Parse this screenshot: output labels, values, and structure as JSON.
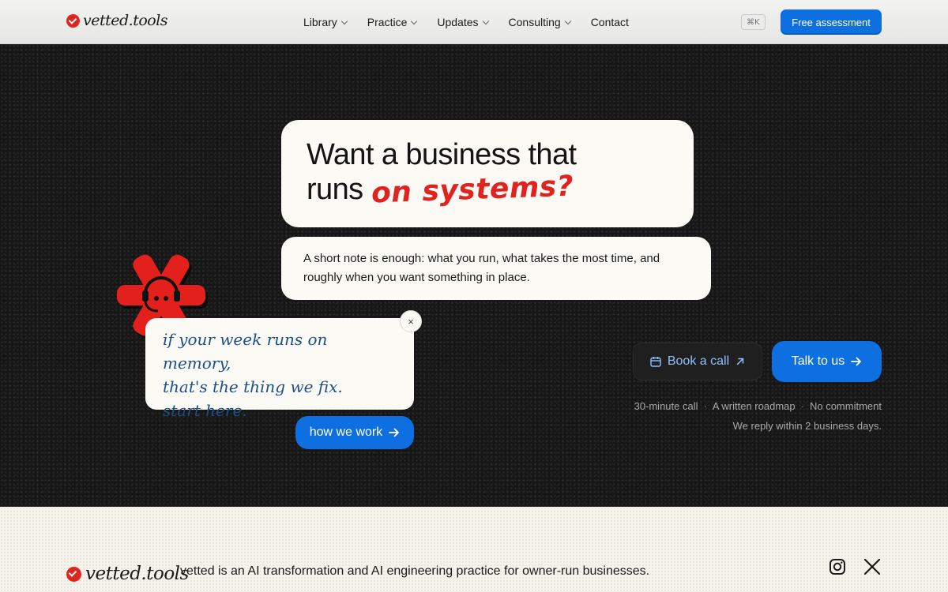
{
  "nav": {
    "brand": "vetted.tools",
    "links": [
      {
        "label": "Library",
        "dropdown": true
      },
      {
        "label": "Practice",
        "dropdown": true
      },
      {
        "label": "Updates",
        "dropdown": true
      },
      {
        "label": "Consulting",
        "dropdown": true
      },
      {
        "label": "Contact",
        "dropdown": false
      }
    ],
    "shortcut": "⌘K",
    "cta": "Free assessment"
  },
  "hero": {
    "title_line1": "Want a business that",
    "title_line2_prefix": "runs",
    "title_accent": "on systems?",
    "note": "A short note is enough: what you run, what takes the most time, and roughly when you want something in place.",
    "sticky_lines": [
      "if your week runs on memory,",
      "that's the thing we fix.",
      "start here."
    ],
    "close_symbol": "×",
    "how_button": "how we work",
    "book_button": "Book a call",
    "talk_button": "Talk to us",
    "meta_items": [
      "30-minute call",
      "A written roadmap",
      "No commitment"
    ],
    "meta_separator": "·",
    "reply_note": "We reply within 2 business days."
  },
  "footer": {
    "brand": "vetted.tools",
    "tagline": "vetted is an AI transformation and AI engineering practice for owner-run businesses.",
    "social": [
      "instagram-icon",
      "x-icon"
    ]
  },
  "colors": {
    "accent_blue": "#0d6fe0",
    "accent_red": "#e2221e",
    "hero_bg": "#161616",
    "handwriting_blue": "#1c4f8a"
  }
}
